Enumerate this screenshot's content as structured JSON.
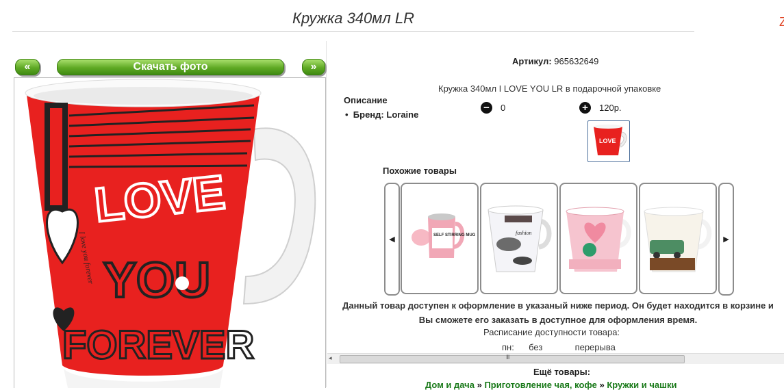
{
  "page": {
    "title": "Кружка 340мл LR",
    "corner_mark": "Z"
  },
  "gallery": {
    "prev_label": "«",
    "download_label": "Скачать фото",
    "next_label": "»",
    "mug_text": {
      "love": "LOVE",
      "you": "YOU",
      "forever": "FOREVER",
      "script": "I love you forever"
    }
  },
  "product": {
    "sku_label": "Артикул:",
    "sku_value": "965632649",
    "full_name": "Кружка 340мл I LOVE YOU LR в подарочной упаковке",
    "description_heading": "Описание",
    "brand_label": "Бренд:",
    "brand_value": "Loraine",
    "quantity": "0",
    "price": "120р.",
    "minus_icon": "minus-icon",
    "plus_icon": "plus-icon",
    "thumb_text": "LOVE"
  },
  "similar": {
    "heading": "Похожие товары",
    "prev_icon": "◀",
    "next_icon": "▶",
    "items": [
      {
        "label": "SELF STIRRING MUG"
      },
      {
        "label": "fashion"
      },
      {
        "label": ""
      },
      {
        "label": ""
      }
    ]
  },
  "availability": {
    "notice": "Данный товар доступен к оформление в указаный ниже период. Он будет находится в корзине и Вы сможете его заказать в доступное для оформления время.",
    "schedule_label": "Расписание доступности товара:",
    "day": "пн:",
    "no_break": "без",
    "break_label": "перерыва"
  },
  "scrollbar": {
    "left_arrow": "◂",
    "grip": "III"
  },
  "more": {
    "heading": "Ещё товары:",
    "crumbs": [
      "Дом и дача",
      "Приготовление чая, кофе",
      "Кружки и чашки"
    ],
    "separator": "»"
  },
  "colors": {
    "mug_red": "#e8211f",
    "button_green": "#5fa924",
    "link_green": "#1a7a1a"
  }
}
